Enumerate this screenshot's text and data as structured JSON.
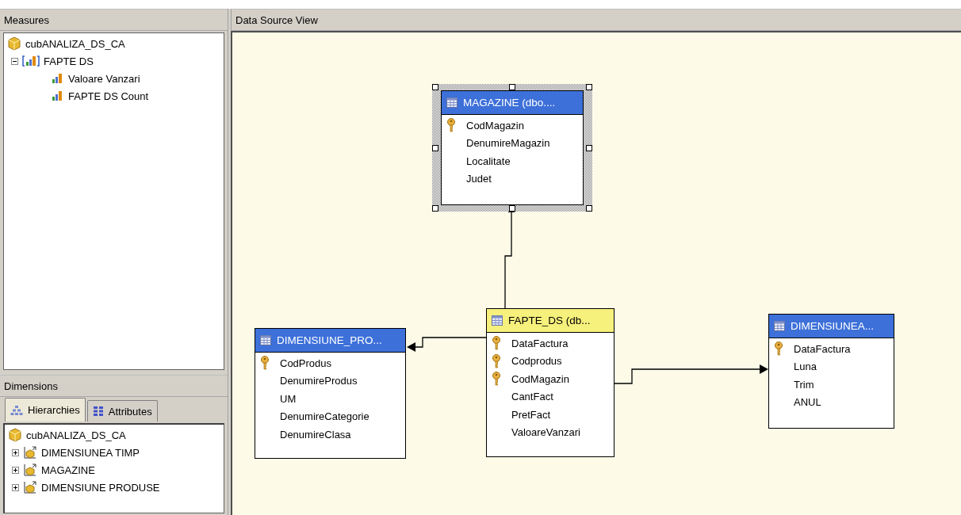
{
  "measures": {
    "title": "Measures",
    "tree": {
      "label": "cubANALIZA_DS_CA",
      "children": [
        {
          "label": "FAPTE DS",
          "expanded": true,
          "children": [
            {
              "label": "Valoare Vanzari"
            },
            {
              "label": "FAPTE DS Count"
            }
          ]
        }
      ]
    }
  },
  "dimensions": {
    "title": "Dimensions",
    "tabs": [
      {
        "label": "Hierarchies",
        "selected": true
      },
      {
        "label": "Attributes",
        "selected": false
      }
    ],
    "tree": {
      "label": "cubANALIZA_DS_CA",
      "children": [
        {
          "label": "DIMENSIUNEA TIMP",
          "expanded": false
        },
        {
          "label": "MAGAZINE",
          "expanded": false
        },
        {
          "label": "DIMENSIUNE PRODUSE",
          "expanded": false
        }
      ]
    }
  },
  "data_source_view": {
    "title": "Data Source View",
    "tables": [
      {
        "title": "MAGAZINE (dbo....",
        "kind": "dimension",
        "selected": true,
        "columns": [
          {
            "name": "CodMagazin",
            "key": true
          },
          {
            "name": "DenumireMagazin",
            "key": false
          },
          {
            "name": "Localitate",
            "key": false
          },
          {
            "name": "Judet",
            "key": false
          }
        ]
      },
      {
        "title": "DIMENSIUNE_PRO...",
        "kind": "dimension",
        "selected": false,
        "columns": [
          {
            "name": "CodProdus",
            "key": true
          },
          {
            "name": "DenumireProdus",
            "key": false
          },
          {
            "name": "UM",
            "key": false
          },
          {
            "name": "DenumireCategorie",
            "key": false
          },
          {
            "name": "DenumireClasa",
            "key": false
          }
        ]
      },
      {
        "title": "FAPTE_DS (db...",
        "kind": "fact",
        "selected": false,
        "columns": [
          {
            "name": "DataFactura",
            "key": true
          },
          {
            "name": "Codprodus",
            "key": true
          },
          {
            "name": "CodMagazin",
            "key": true
          },
          {
            "name": "CantFact",
            "key": false
          },
          {
            "name": "PretFact",
            "key": false
          },
          {
            "name": "ValoareVanzari",
            "key": false
          }
        ]
      },
      {
        "title": "DIMENSIUNEA...",
        "kind": "dimension",
        "selected": false,
        "columns": [
          {
            "name": "DataFactura",
            "key": true
          },
          {
            "name": "Luna",
            "key": false
          },
          {
            "name": "Trim",
            "key": false
          },
          {
            "name": "ANUL",
            "key": false
          }
        ]
      }
    ]
  }
}
